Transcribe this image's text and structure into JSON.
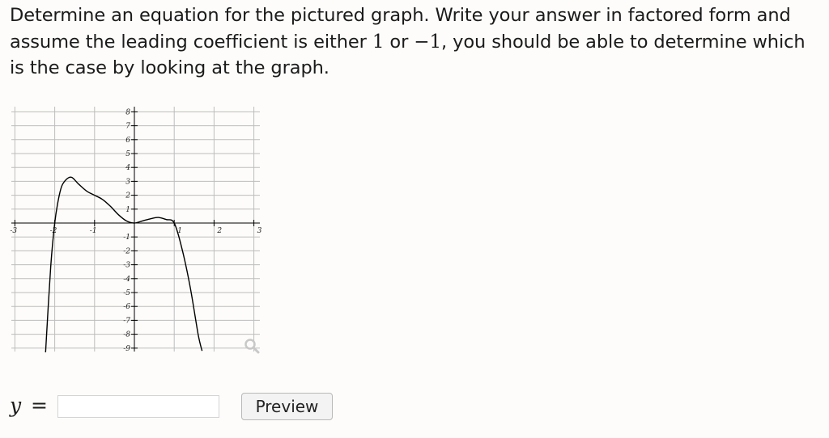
{
  "question": {
    "part1": "Determine an equation for the pictured graph. Write your answer in factored form and assume the leading coefficient is either ",
    "coef_pos": "1",
    "or": " or ",
    "coef_neg": "−1",
    "part2": ", you should be able to determine which is the case by looking at the graph."
  },
  "chart_data": {
    "type": "line",
    "title": "",
    "xlabel": "",
    "ylabel": "",
    "xlim": [
      -3,
      3
    ],
    "ylim": [
      -9,
      8
    ],
    "x_ticks": [
      "-3",
      "-2",
      "-1",
      "1",
      "2",
      "3"
    ],
    "y_ticks": [
      "8",
      "7",
      "6",
      "5",
      "4",
      "3",
      "2",
      "1",
      "-1",
      "-2",
      "-3",
      "-4",
      "-5",
      "-6",
      "-7",
      "-8",
      "-9"
    ],
    "grid": true,
    "series": [
      {
        "color": "#000000",
        "x": [
          -2.23,
          -2.1,
          -2.0,
          -1.9,
          -1.8,
          -1.6,
          -1.4,
          -1.2,
          -1.0,
          -0.8,
          -0.6,
          -0.4,
          -0.2,
          0.0,
          0.2,
          0.4,
          0.6,
          0.8,
          1.0,
          1.2,
          1.4,
          1.6,
          1.7
        ],
        "y": [
          -9.3,
          -3.1,
          0.0,
          1.8,
          2.8,
          3.3,
          2.8,
          2.3,
          2.0,
          1.7,
          1.2,
          0.6,
          0.15,
          0.0,
          0.15,
          0.3,
          0.4,
          0.25,
          0.0,
          -1.9,
          -4.6,
          -8.0,
          -9.2
        ]
      }
    ],
    "roots": [
      -2,
      0,
      1
    ]
  },
  "icons": {
    "magnifier": "zoom-magnifier-icon"
  },
  "answer": {
    "y_label": "y",
    "equals": "=",
    "value": "",
    "placeholder": "",
    "preview_label": "Preview"
  }
}
